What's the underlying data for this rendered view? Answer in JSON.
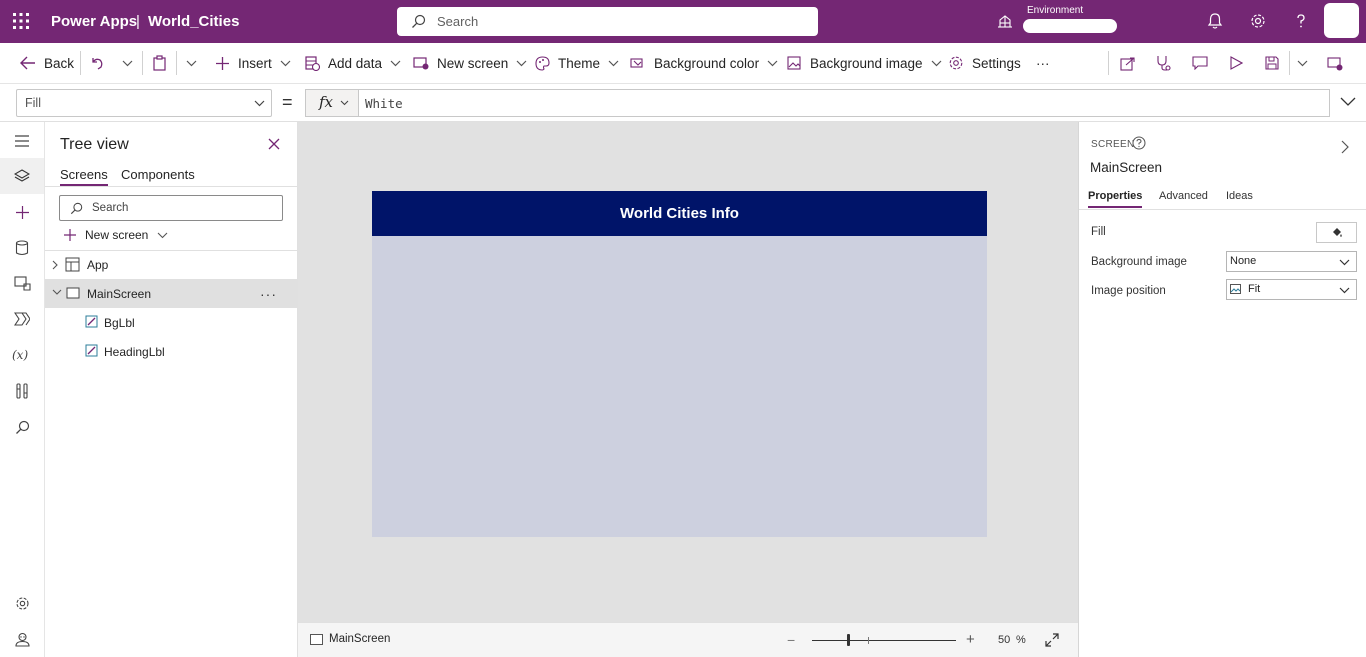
{
  "topbar": {
    "app_name": "Power Apps",
    "separator": "|",
    "document_name": "World_Cities",
    "search_placeholder": "Search",
    "environment_label": "Environment",
    "icons": [
      "waffle-icon",
      "search-icon",
      "environment-icon",
      "bell-icon",
      "gear-icon",
      "help-icon"
    ]
  },
  "command_bar": {
    "back": "Back",
    "insert": "Insert",
    "add_data": "Add data",
    "new_screen": "New screen",
    "theme": "Theme",
    "background_color": "Background color",
    "background_image": "Background image",
    "settings": "Settings",
    "more": "···"
  },
  "formula_bar": {
    "property": "Fill",
    "equals": "=",
    "fx": "fx",
    "formula": "White"
  },
  "tree_view": {
    "title": "Tree view",
    "tabs": [
      "Screens",
      "Components"
    ],
    "search_placeholder": "Search",
    "new_screen": "New screen",
    "nodes": [
      {
        "label": "App"
      },
      {
        "label": "MainScreen"
      },
      {
        "label": "BgLbl"
      },
      {
        "label": "HeadingLbl"
      }
    ],
    "more": "···"
  },
  "canvas": {
    "heading_text": "World Cities Info",
    "heading_color": "#001469",
    "background_color": "#cdd0df"
  },
  "status_bar": {
    "screen_name": "MainScreen",
    "zoom_minus": "−",
    "zoom_plus": "+",
    "zoom_value": "50",
    "zoom_unit": "%"
  },
  "properties": {
    "type_label": "SCREEN",
    "name": "MainScreen",
    "tabs": [
      "Properties",
      "Advanced",
      "Ideas"
    ],
    "fill_label": "Fill",
    "background_image_label": "Background image",
    "background_image_value": "None",
    "image_position_label": "Image position",
    "image_position_value": "Fit"
  },
  "colors": {
    "brand": "#742774",
    "accent": "#742774"
  }
}
